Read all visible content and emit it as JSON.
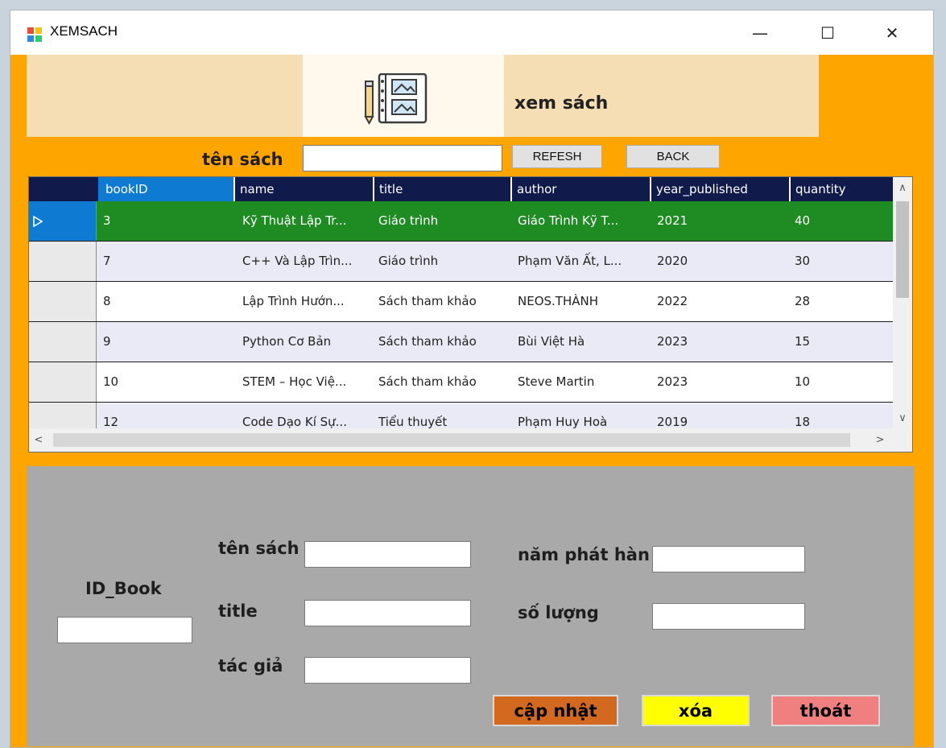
{
  "window": {
    "title": "XEMSACH",
    "min_symbol": "—",
    "max_symbol": "☐",
    "close_symbol": "✕"
  },
  "header": {
    "title": "xem sách",
    "logo_icon": "notebook-icon"
  },
  "search": {
    "label": "tên sách",
    "value": "",
    "refresh_label": "REFESH",
    "back_label": "BACK"
  },
  "grid": {
    "columns": [
      "bookID",
      "name",
      "title",
      "author",
      "year_published",
      "quantity"
    ],
    "selected_row_index": 0,
    "rows": [
      [
        "3",
        "Kỹ Thuật Lập Tr...",
        "Giáo trình",
        "Giáo Trình Kỹ T...",
        "2021",
        "40"
      ],
      [
        "7",
        "C++ Và Lập Trìn...",
        "Giáo trình",
        "Phạm Văn Ất, L...",
        "2020",
        "30"
      ],
      [
        "8",
        "Lập Trình Hướn...",
        "Sách tham khảo",
        "NEOS.THÀNH",
        "2022",
        "28"
      ],
      [
        "9",
        "Python Cơ Bản",
        "Sách tham khảo",
        "Bùi Việt Hà",
        "2023",
        "15"
      ],
      [
        "10",
        "STEM – Học Việ...",
        "Sách tham khảo",
        "Steve Martin",
        "2023",
        "10"
      ],
      [
        "12",
        "Code Dạo Kí Sự...",
        "Tiểu thuyết",
        "Phạm Huy Hoà",
        "2019",
        "18"
      ]
    ],
    "colors": {
      "header": "#101a4b",
      "selected_col_header": "#0e7ad1",
      "selected_row": "#1e8b23"
    }
  },
  "form": {
    "id_label": "ID_Book",
    "name_label": "tên sách",
    "title_label": "title",
    "author_label": "tác giả",
    "year_label": "năm phát hàn",
    "qty_label": "số lượng",
    "id_value": "",
    "name_value": "",
    "title_value": "",
    "author_value": "",
    "year_value": "",
    "qty_value": ""
  },
  "actions": {
    "update_label": "cập nhật",
    "delete_label": "xóa",
    "exit_label": "thoát",
    "colors": {
      "update": "#d2691e",
      "delete": "#ffff00",
      "exit": "#f08080"
    }
  }
}
